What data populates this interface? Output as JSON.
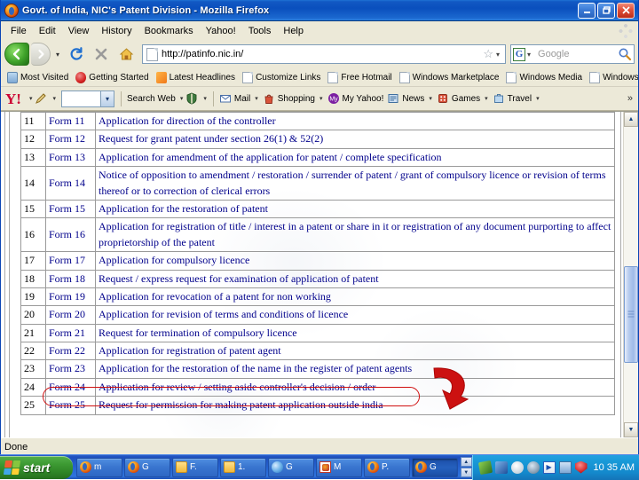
{
  "window": {
    "title": "Govt. of India, NIC's Patent Division  -  Mozilla Firefox",
    "minimize_label": "–",
    "restore_label": "❐",
    "close_label": "✕"
  },
  "menu": {
    "items": [
      "File",
      "Edit",
      "View",
      "History",
      "Bookmarks",
      "Yahoo!",
      "Tools",
      "Help"
    ]
  },
  "nav": {
    "back_label": "◀",
    "forward_label": "▶",
    "dropdown_label": "▾",
    "reload_label": "↻",
    "stop_label": "✕",
    "home_label": "⌂",
    "url": "http://patinfo.nic.in/",
    "url_star": "☆",
    "url_caret": "▾",
    "search_engine": "G",
    "search_caret": "▾",
    "search_placeholder": "Google"
  },
  "bookmarks": {
    "items": [
      {
        "label": "Most Visited",
        "icon": "visited-icon"
      },
      {
        "label": "Getting Started",
        "icon": "getting-started-icon"
      },
      {
        "label": "Latest Headlines",
        "icon": "rss-icon"
      },
      {
        "label": "Customize Links",
        "icon": "page-icon"
      },
      {
        "label": "Free Hotmail",
        "icon": "page-icon"
      },
      {
        "label": "Windows Marketplace",
        "icon": "page-icon"
      },
      {
        "label": "Windows Media",
        "icon": "page-icon"
      },
      {
        "label": "Windows",
        "icon": "page-icon"
      }
    ]
  },
  "yahoo_toolbar": {
    "logo": "Y!",
    "caret": "▾",
    "search_value": "",
    "dropdown_label": "▾",
    "items": [
      {
        "label": "Search Web",
        "icon": "search-web-icon"
      },
      {
        "label": "Mail",
        "icon": "mail-icon"
      },
      {
        "label": "Shopping",
        "icon": "shopping-icon"
      },
      {
        "label": "My Yahoo!",
        "icon": "my-yahoo-icon"
      },
      {
        "label": "News",
        "icon": "news-icon"
      },
      {
        "label": "Games",
        "icon": "games-icon"
      },
      {
        "label": "Travel",
        "icon": "travel-icon"
      }
    ],
    "overflow_label": "»"
  },
  "page": {
    "table_rows": [
      {
        "num": "11",
        "form": "Form 11",
        "desc": "Application for direction of the controller",
        "tall": false
      },
      {
        "num": "12",
        "form": "Form 12",
        "desc": "Request for grant patent under section 26(1) & 52(2)",
        "tall": false
      },
      {
        "num": "13",
        "form": "Form 13",
        "desc": "Application for amendment of the application for patent / complete specification",
        "tall": false
      },
      {
        "num": "14",
        "form": "Form 14",
        "desc": "Notice of opposition to amendment / restoration / surrender of patent / grant of compulsory licence or revision of terms thereof or to correction of clerical errors",
        "tall": true
      },
      {
        "num": "15",
        "form": "Form 15",
        "desc": "Application for the restoration of patent",
        "tall": false
      },
      {
        "num": "16",
        "form": "Form 16",
        "desc": "Application for registration of title / interest in a patent or share in it or registration of any document purporting to affect proprietorship of the patent",
        "tall": true
      },
      {
        "num": "17",
        "form": "Form 17",
        "desc": "Application for compulsory licence",
        "tall": false
      },
      {
        "num": "18",
        "form": "Form 18",
        "desc": "Request / express request for examination of application of patent",
        "tall": false
      },
      {
        "num": "19",
        "form": "Form 19",
        "desc": "Application for revocation of a patent for non working",
        "tall": false
      },
      {
        "num": "20",
        "form": "Form 20",
        "desc": "Application for revision of terms and conditions of licence",
        "tall": false
      },
      {
        "num": "21",
        "form": "Form 21",
        "desc": "Request for termination of compulsory licence",
        "tall": false
      },
      {
        "num": "22",
        "form": "Form 22",
        "desc": "Application for registration of patent agent",
        "tall": false
      },
      {
        "num": "23",
        "form": "Form 23",
        "desc": "Application for the restoration of the name in the register of patent agents",
        "tall": false
      },
      {
        "num": "24",
        "form": "Form 24",
        "desc": "Application for review / setting aside controller's decision / order",
        "tall": false
      },
      {
        "num": "25",
        "form": "Form 25",
        "desc": "Request for permission for making patent application outside india",
        "tall": false
      }
    ],
    "annotation": {
      "highlighted_row": "18",
      "color": "#d01010"
    },
    "scrollbar": {
      "up_label": "▲",
      "down_label": "▼"
    }
  },
  "status": {
    "text": "Done"
  },
  "taskbar": {
    "start_label": "start",
    "tasks": [
      {
        "label": "m",
        "icon": "firefox-icon",
        "active": false
      },
      {
        "label": "G",
        "icon": "firefox-icon",
        "active": false
      },
      {
        "label": "F.",
        "icon": "folder-icon",
        "active": false
      },
      {
        "label": "1.",
        "icon": "folder-icon",
        "active": false
      },
      {
        "label": "G",
        "icon": "internet-explorer-icon",
        "active": false
      },
      {
        "label": "M",
        "icon": "image-viewer-icon",
        "active": false
      },
      {
        "label": "P.",
        "icon": "firefox-icon",
        "active": false
      },
      {
        "label": "G",
        "icon": "firefox-icon",
        "active": true
      }
    ],
    "scroll_up": "▲",
    "scroll_down": "▼",
    "tray_icons": [
      "network-icon",
      "display-icon",
      "messenger-icon",
      "volume-icon",
      "media-player-icon",
      "update-icon",
      "security-icon"
    ],
    "clock": "10 35 AM"
  }
}
